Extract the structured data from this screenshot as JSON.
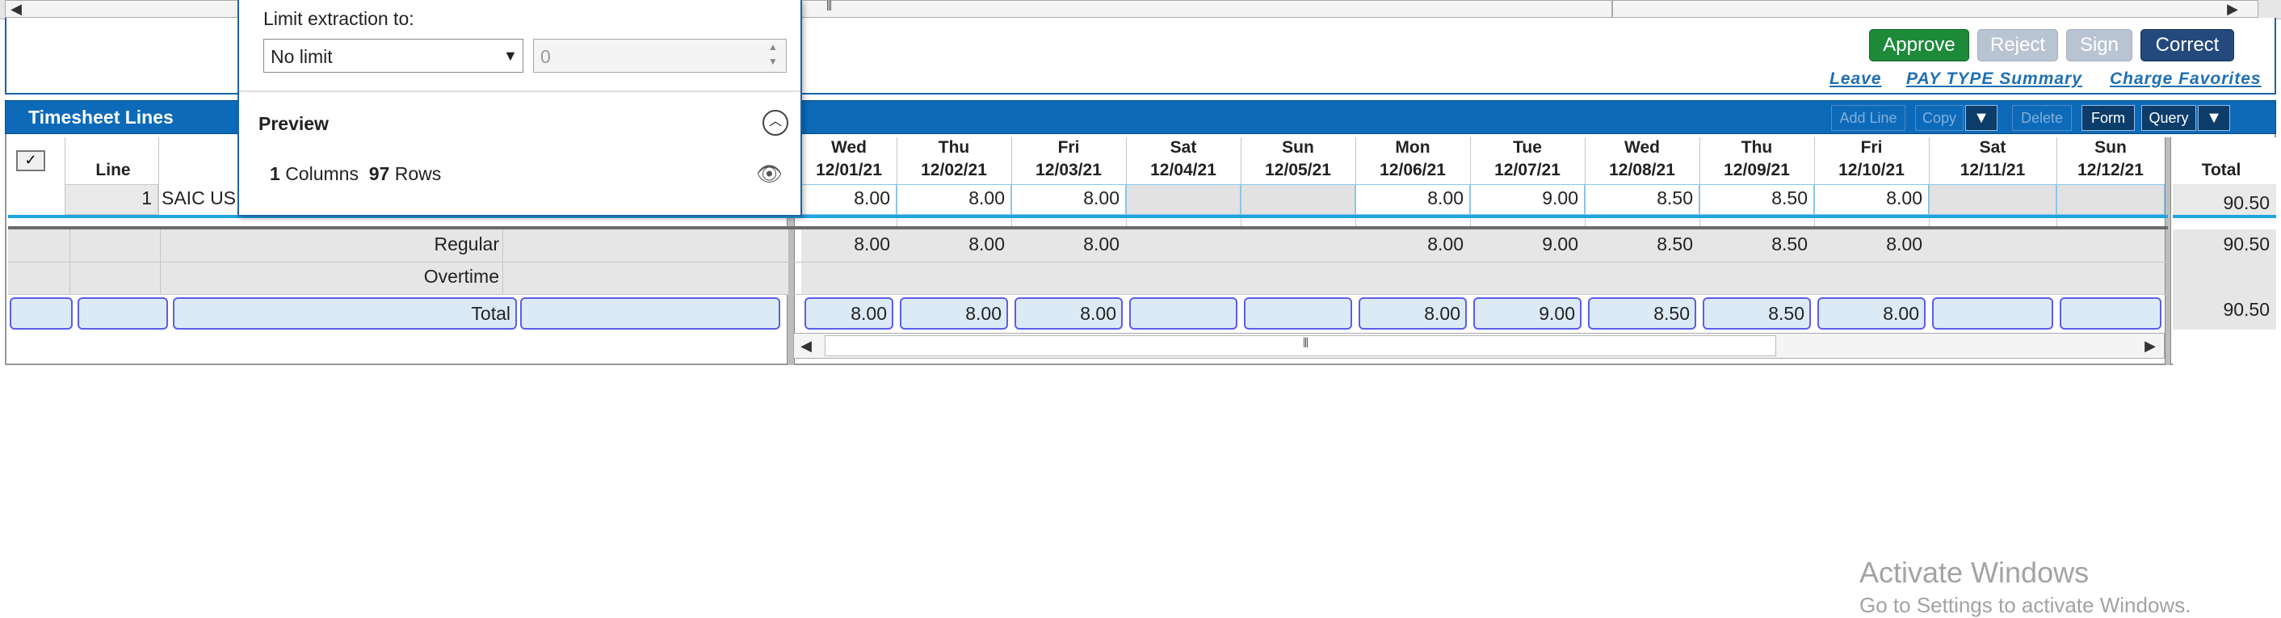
{
  "top_scroll": {
    "left_arrow": "◀",
    "right_arrow": "▶",
    "thumb_grip": "⦀"
  },
  "actions": {
    "approve": "Approve",
    "reject": "Reject",
    "sign": "Sign",
    "correct": "Correct",
    "leave": "Leave",
    "pay_type_summary": "PAY TYPE Summary",
    "charge_favorites": "Charge Favorites"
  },
  "section": {
    "title": "Timesheet Lines",
    "add_line": "Add Line",
    "copy": "Copy",
    "delete": "Delete",
    "form": "Form",
    "query": "Query"
  },
  "popup": {
    "limit_label": "Limit extraction to:",
    "limit_value": "No limit",
    "limit_number": "0",
    "preview_label": "Preview",
    "columns_count": "1",
    "columns_label": "Columns",
    "rows_count": "97",
    "rows_label": "Rows"
  },
  "grid": {
    "line_header": "Line",
    "line_number": "1",
    "charge_prefix": "SAIC US",
    "total_header": "Total",
    "days": [
      {
        "dow": "Wed",
        "date": "12/01/21",
        "entry": "8.00",
        "regular": "8.00",
        "overtime": "",
        "total": "8.00"
      },
      {
        "dow": "Thu",
        "date": "12/02/21",
        "entry": "8.00",
        "regular": "8.00",
        "overtime": "",
        "total": "8.00"
      },
      {
        "dow": "Fri",
        "date": "12/03/21",
        "entry": "8.00",
        "regular": "8.00",
        "overtime": "",
        "total": "8.00"
      },
      {
        "dow": "Sat",
        "date": "12/04/21",
        "entry": "",
        "regular": "",
        "overtime": "",
        "total": ""
      },
      {
        "dow": "Sun",
        "date": "12/05/21",
        "entry": "",
        "regular": "",
        "overtime": "",
        "total": ""
      },
      {
        "dow": "Mon",
        "date": "12/06/21",
        "entry": "8.00",
        "regular": "8.00",
        "overtime": "",
        "total": "8.00"
      },
      {
        "dow": "Tue",
        "date": "12/07/21",
        "entry": "9.00",
        "regular": "9.00",
        "overtime": "",
        "total": "9.00"
      },
      {
        "dow": "Wed",
        "date": "12/08/21",
        "entry": "8.50",
        "regular": "8.50",
        "overtime": "",
        "total": "8.50"
      },
      {
        "dow": "Thu",
        "date": "12/09/21",
        "entry": "8.50",
        "regular": "8.50",
        "overtime": "",
        "total": "8.50"
      },
      {
        "dow": "Fri",
        "date": "12/10/21",
        "entry": "8.00",
        "regular": "8.00",
        "overtime": "",
        "total": "8.00"
      },
      {
        "dow": "Sat",
        "date": "12/11/21",
        "entry": "",
        "regular": "",
        "overtime": "",
        "total": ""
      },
      {
        "dow": "Sun",
        "date": "12/12/21",
        "entry": "",
        "regular": "",
        "overtime": "",
        "total": ""
      }
    ],
    "row_total": "90.50",
    "summary": {
      "regular_label": "Regular",
      "overtime_label": "Overtime",
      "total_label": "Total",
      "regular_total": "90.50",
      "total_total": "90.50"
    }
  },
  "watermark": {
    "line1": "Activate Windows",
    "line2": "Go to Settings to activate Windows."
  },
  "colors": {
    "approve": "#1d8a3a",
    "correct": "#23497d",
    "section_bar": "#0d6ab8",
    "selected_cell": "#dceaf6",
    "total_border": "#5b5ee8"
  }
}
